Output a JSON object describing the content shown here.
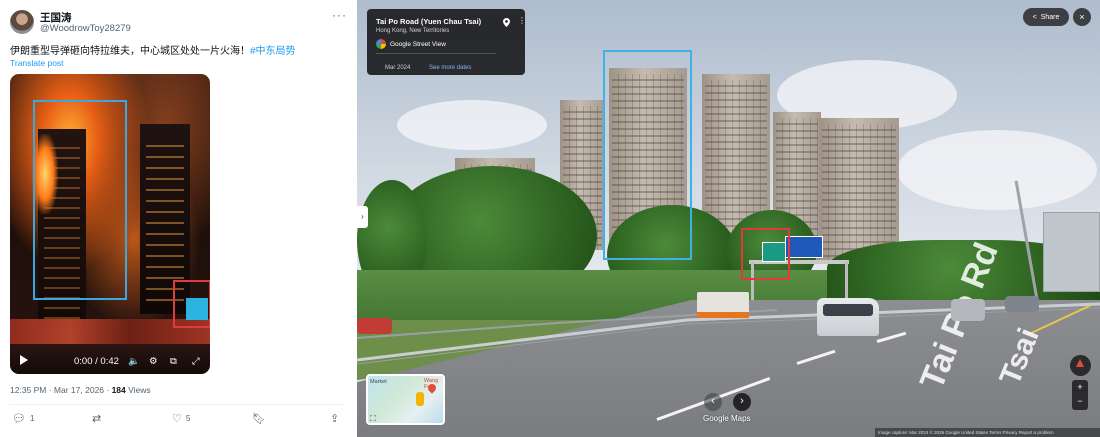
{
  "tweet": {
    "author_name": "王国涛",
    "author_handle": "@WoodrowToy28279",
    "text_main": "伊朗重型导弹砸向特拉维夫，中心城区处处一片火海！",
    "hashtag": "#中东局势",
    "translate": "Translate post",
    "video": {
      "time": "0:00 / 0:42"
    },
    "timestamp": "12:35 PM · Mar 17, 2026 · ",
    "views_count": "184",
    "views_label": " Views",
    "actions": {
      "replies": "1",
      "likes": "5"
    },
    "icons": [
      "more-icon",
      "play-icon",
      "volume-icon",
      "settings-icon",
      "pip-icon",
      "fullscreen-icon",
      "reply-icon",
      "retweet-icon",
      "like-icon",
      "bookmark-icon",
      "share-icon"
    ]
  },
  "streetview": {
    "location_title": "Tai Po Road (Yuen Chau Tsai)",
    "location_sub": "Hong Kong, New Territories",
    "provider": "Google Street View",
    "capture_date": "Mar 2024",
    "see_more": "See more dates",
    "share_label": "Share",
    "close_label": "×",
    "map_label_left": "Market",
    "map_label_right": "Wang Fuk",
    "logo": "Google Maps",
    "road_text_1": "Tai Po Rd",
    "road_text_2": "Tsai",
    "footer": "Image capture: Mar 2024   © 2026 Google   United States   Terms   Privacy   Report a problem",
    "zoom_in": "+",
    "zoom_out": "−"
  },
  "colors": {
    "highlight_blue": "#3fb1e6",
    "highlight_red": "#e03a3a",
    "link_blue": "#1d9bf0"
  }
}
